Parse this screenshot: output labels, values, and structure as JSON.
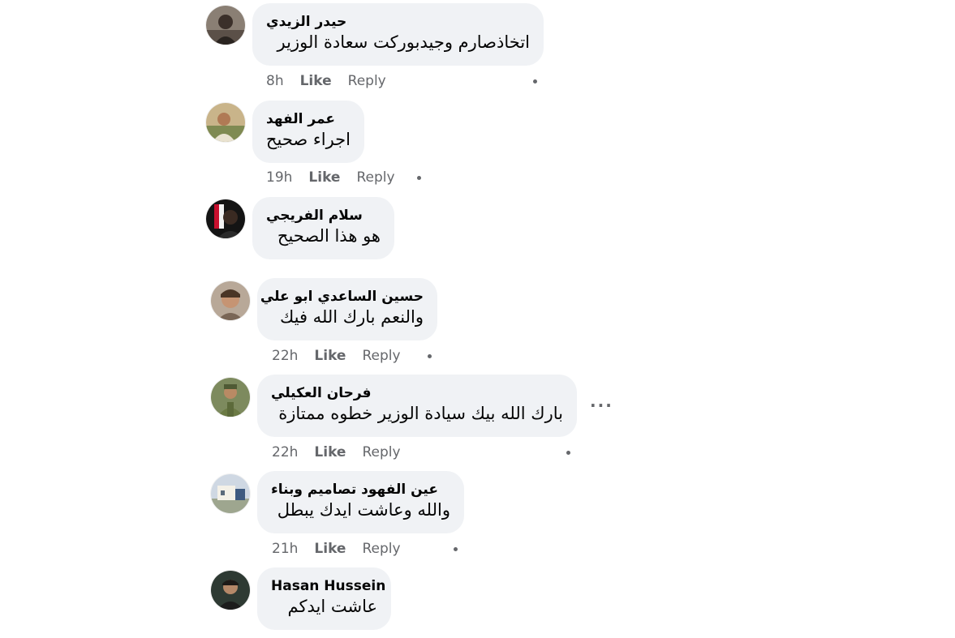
{
  "comments": [
    {
      "author": "حيدر الزيدي",
      "text": "اتخاذصارم وجيدبوركت سعادة الوزير",
      "time": "8h",
      "like_label": "Like",
      "reply_label": "Reply"
    },
    {
      "author": "عمر الفهد",
      "text": "اجراء صحيح",
      "time": "19h",
      "like_label": "Like",
      "reply_label": "Reply"
    },
    {
      "author": "سلام الفريجي",
      "text": "هو هذا الصحيح"
    },
    {
      "author": "حسين الساعدي ابو علي",
      "text": "والنعم بارك الله فيك",
      "time": "22h",
      "like_label": "Like",
      "reply_label": "Reply"
    },
    {
      "author": "فرحان العكيلي",
      "text": "بارك الله بيك سيادة الوزير خطوه ممتازة",
      "time": "22h",
      "like_label": "Like",
      "reply_label": "Reply",
      "more_label": "···"
    },
    {
      "author": "عين الفهود تصاميم وبناء",
      "text": "والله وعاشت ايدك يبطل",
      "time": "21h",
      "like_label": "Like",
      "reply_label": "Reply"
    },
    {
      "author": "Hasan Hussein",
      "text": "عاشت ايدكم"
    }
  ]
}
